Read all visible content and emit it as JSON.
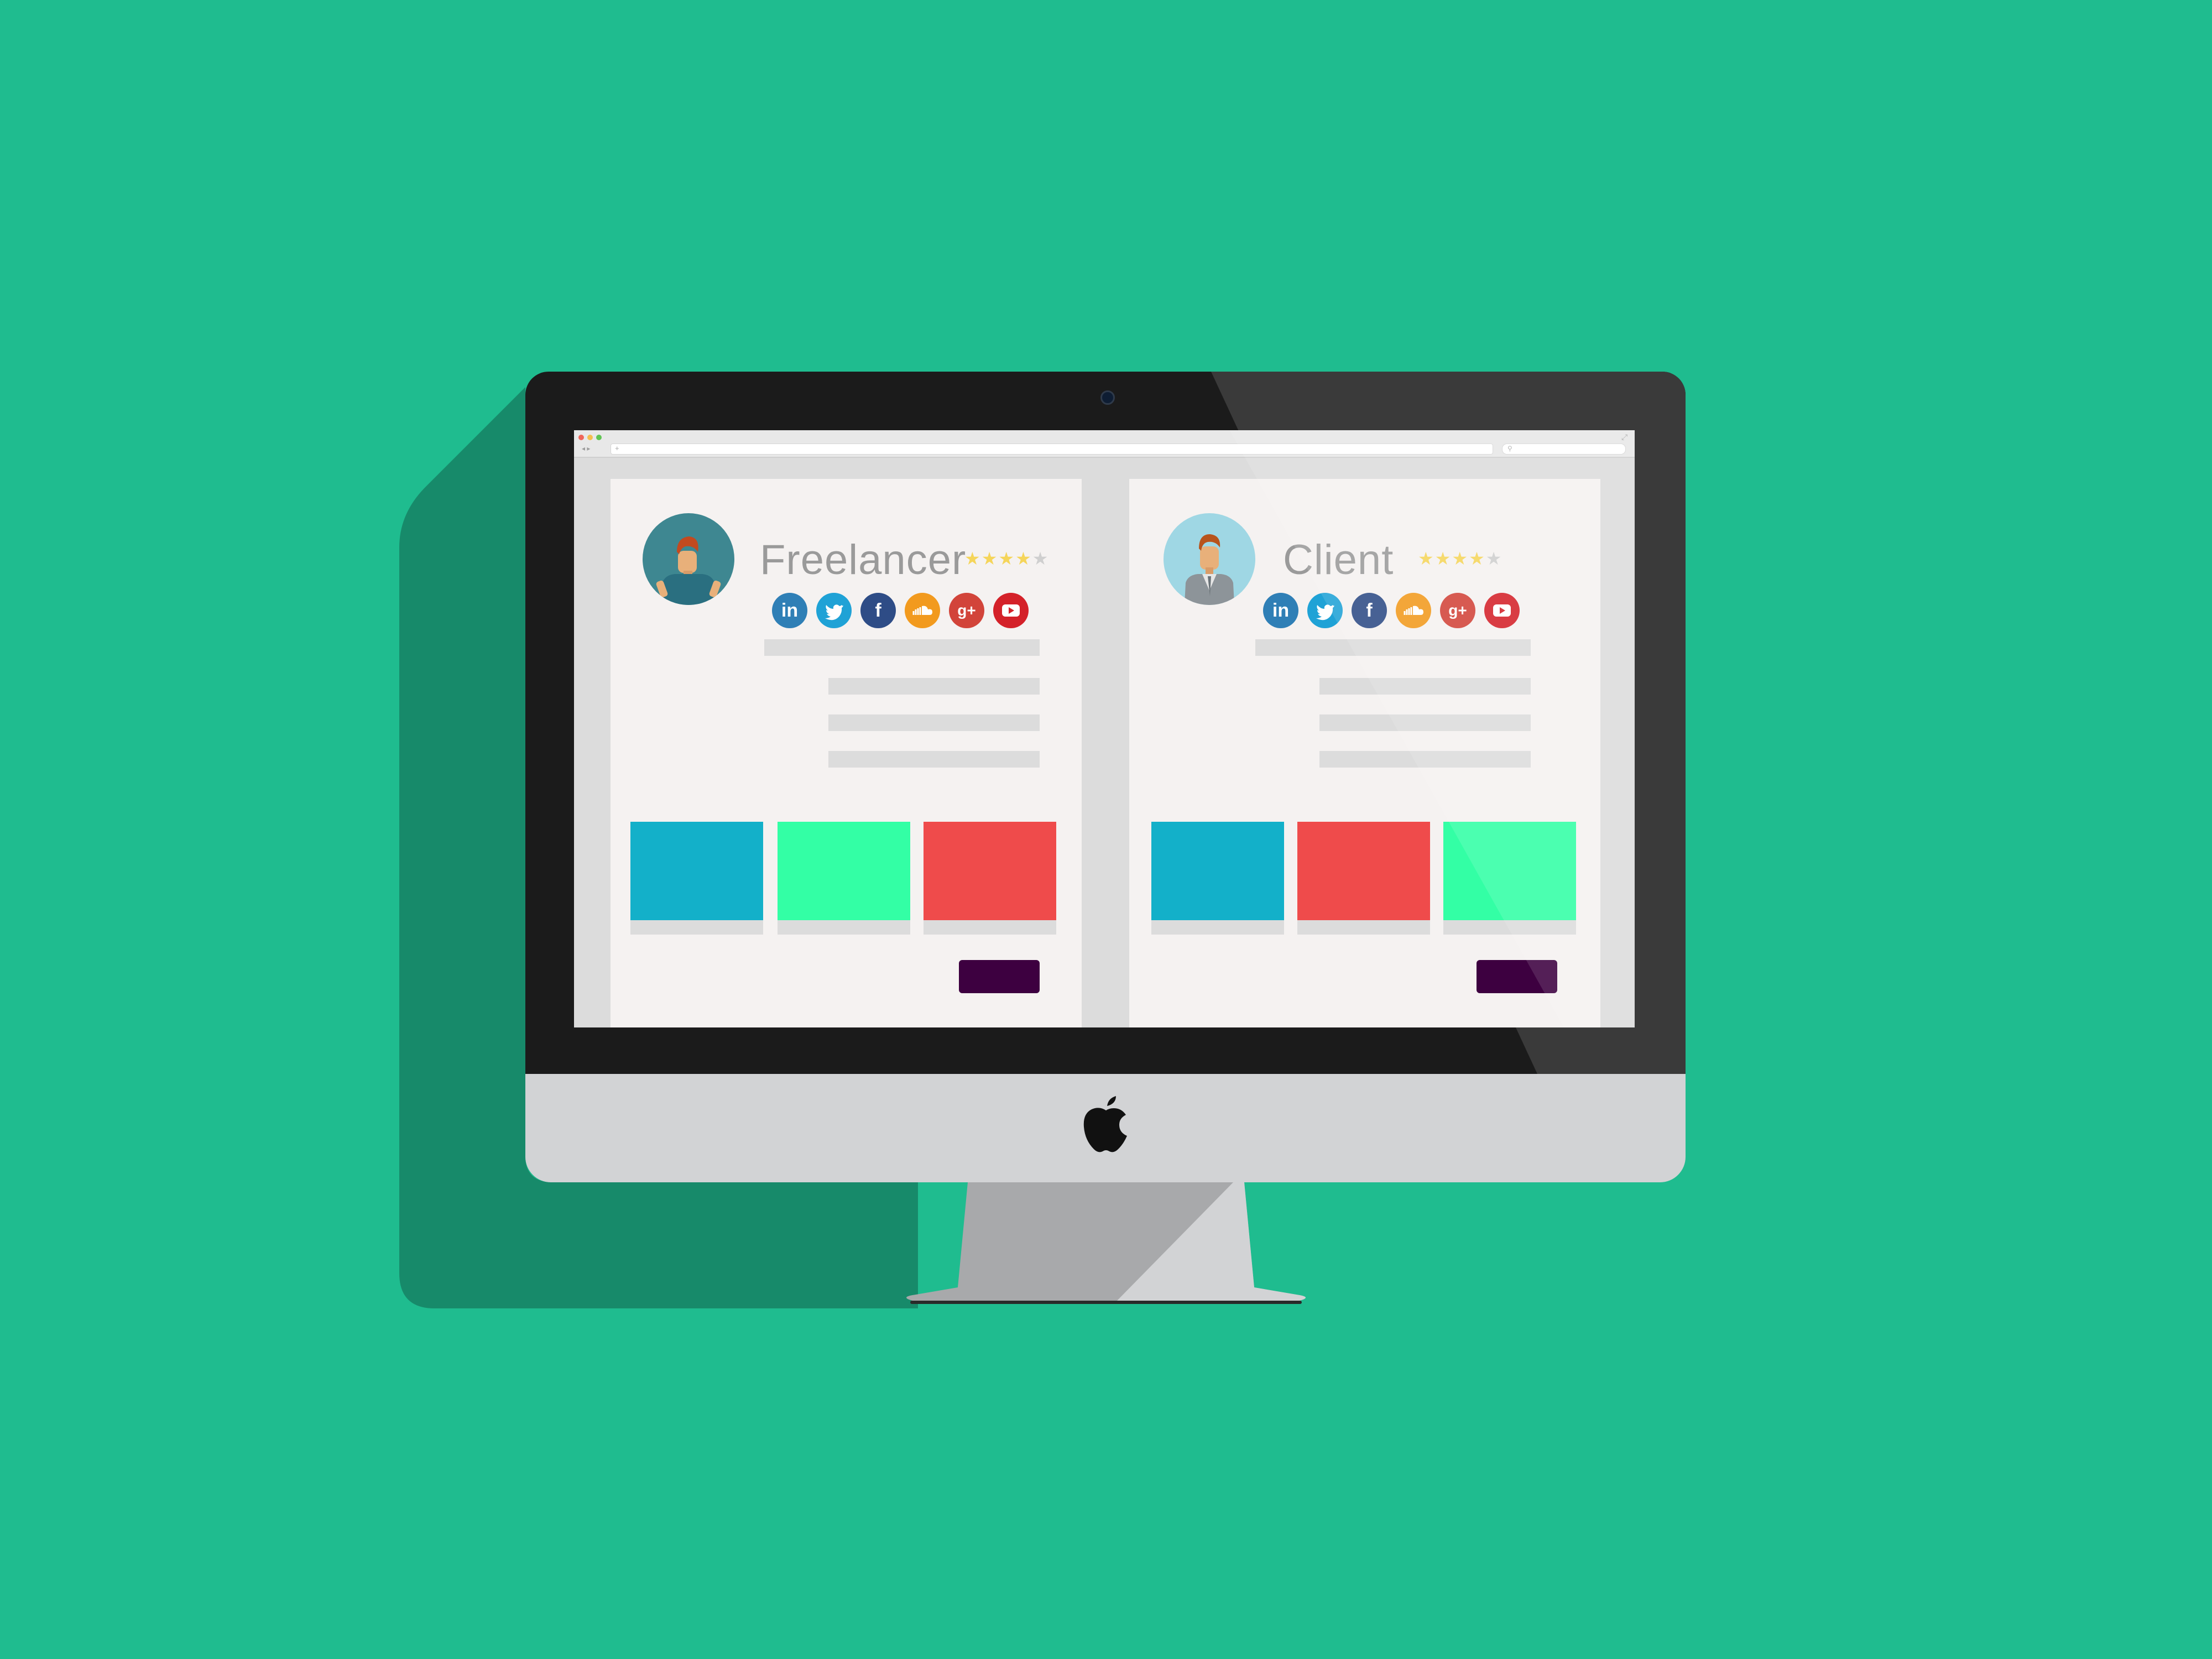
{
  "colors": {
    "background": "#1fbc8f",
    "shadow": "#178a6a",
    "bezel": "#1b1b1b",
    "chin": "#d2d3d5",
    "card": "#f5f2f1",
    "placeholder": "#dcdcdc",
    "button": "#3d0040",
    "tile_blue": "#13b0c9",
    "tile_green": "#33ffa5",
    "tile_red": "#ef4b4b"
  },
  "browser": {
    "traffic_lights": [
      "#f0665a",
      "#f5bf4f",
      "#61c554"
    ],
    "address_placeholder": "+",
    "nav": "◂ ▸"
  },
  "profiles": [
    {
      "title": "Freelancer",
      "rating": 4,
      "rating_max": 5,
      "avatar_bg": "#3e8791",
      "social_icons": [
        "linkedin-icon",
        "twitter-icon",
        "facebook-icon",
        "soundcloud-icon",
        "googleplus-icon",
        "youtube-icon"
      ],
      "tiles": [
        "#13b0c9",
        "#33ffa5",
        "#ef4b4b"
      ]
    },
    {
      "title": "Client",
      "rating": 4,
      "rating_max": 5,
      "avatar_bg": "#9fd7e4",
      "social_icons": [
        "linkedin-icon",
        "twitter-icon",
        "facebook-icon",
        "soundcloud-icon",
        "googleplus-icon",
        "youtube-icon"
      ],
      "tiles": [
        "#13b0c9",
        "#ef4b4b",
        "#33ffa5"
      ]
    }
  ],
  "social": {
    "linkedin": "in",
    "facebook": "f",
    "googleplus": "g+"
  },
  "logo": "apple-logo"
}
